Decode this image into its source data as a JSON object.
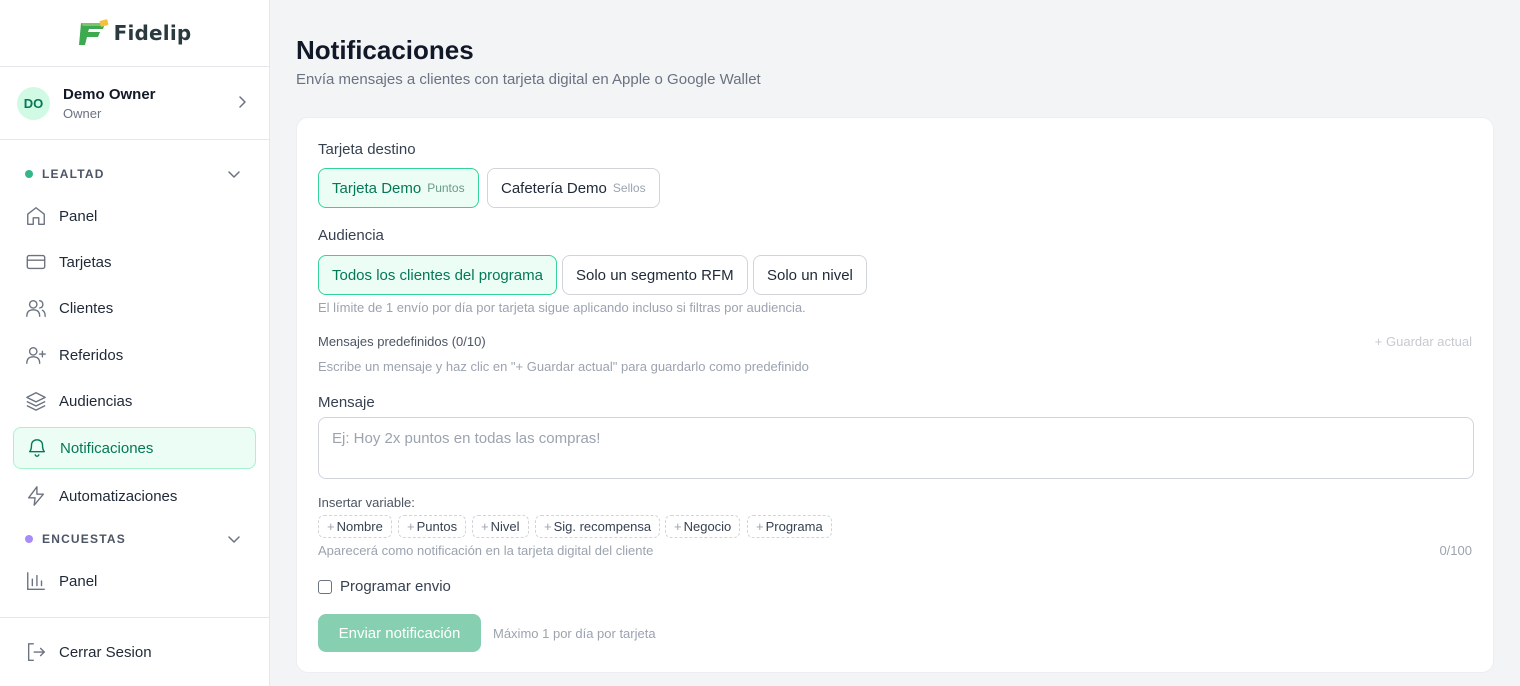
{
  "brand": {
    "name": "Fidelip",
    "accent": "#10b981"
  },
  "user": {
    "initials": "DO",
    "name": "Demo Owner",
    "role": "Owner"
  },
  "sidebar": {
    "sections": [
      {
        "label": "LEALTAD",
        "dot_color": "#34b58a"
      },
      {
        "label": "ENCUESTAS",
        "dot_color": "#a78bfa"
      }
    ],
    "items": [
      {
        "label": "Panel",
        "icon": "home-icon"
      },
      {
        "label": "Tarjetas",
        "icon": "card-icon"
      },
      {
        "label": "Clientes",
        "icon": "users-icon"
      },
      {
        "label": "Referidos",
        "icon": "user-plus-icon"
      },
      {
        "label": "Audiencias",
        "icon": "layers-icon"
      },
      {
        "label": "Notificaciones",
        "icon": "bell-icon",
        "active": true
      },
      {
        "label": "Automatizaciones",
        "icon": "zap-icon"
      }
    ],
    "survey_items": [
      {
        "label": "Panel",
        "icon": "bar-chart-icon"
      }
    ],
    "logout": "Cerrar Sesion"
  },
  "page": {
    "title": "Notificaciones",
    "subtitle": "Envía mensajes a clientes con tarjeta digital en Apple o Google Wallet"
  },
  "form": {
    "target_label": "Tarjeta destino",
    "targets": [
      {
        "name": "Tarjeta Demo",
        "type": "Puntos",
        "selected": true
      },
      {
        "name": "Cafetería Demo",
        "type": "Sellos",
        "selected": false
      }
    ],
    "audience_label": "Audiencia",
    "audiences": [
      {
        "label": "Todos los clientes del programa",
        "selected": true
      },
      {
        "label": "Solo un segmento RFM",
        "selected": false
      },
      {
        "label": "Solo un nivel",
        "selected": false
      }
    ],
    "audience_hint": "El límite de 1 envío por día por tarjeta sigue aplicando incluso si filtras por audiencia.",
    "presets_label": "Mensajes predefinidos (0/10)",
    "save_current": "+ Guardar actual",
    "presets_hint": "Escribe un mensaje y haz clic en \"+ Guardar actual\" para guardarlo como predefinido",
    "message_label": "Mensaje",
    "message_placeholder": "Ej: Hoy 2x puntos en todas las compras!",
    "message_value": "",
    "insert_variable_label": "Insertar variable:",
    "variables": [
      "Nombre",
      "Puntos",
      "Nivel",
      "Sig. recompensa",
      "Negocio",
      "Programa"
    ],
    "variable_plus": "+",
    "message_hint": "Aparecerá como notificación en la tarjeta digital del cliente",
    "char_count": "0/100",
    "schedule_label": "Programar envio",
    "schedule_checked": false,
    "send_label": "Enviar notificación",
    "send_note": "Máximo 1 por día por tarjeta"
  }
}
